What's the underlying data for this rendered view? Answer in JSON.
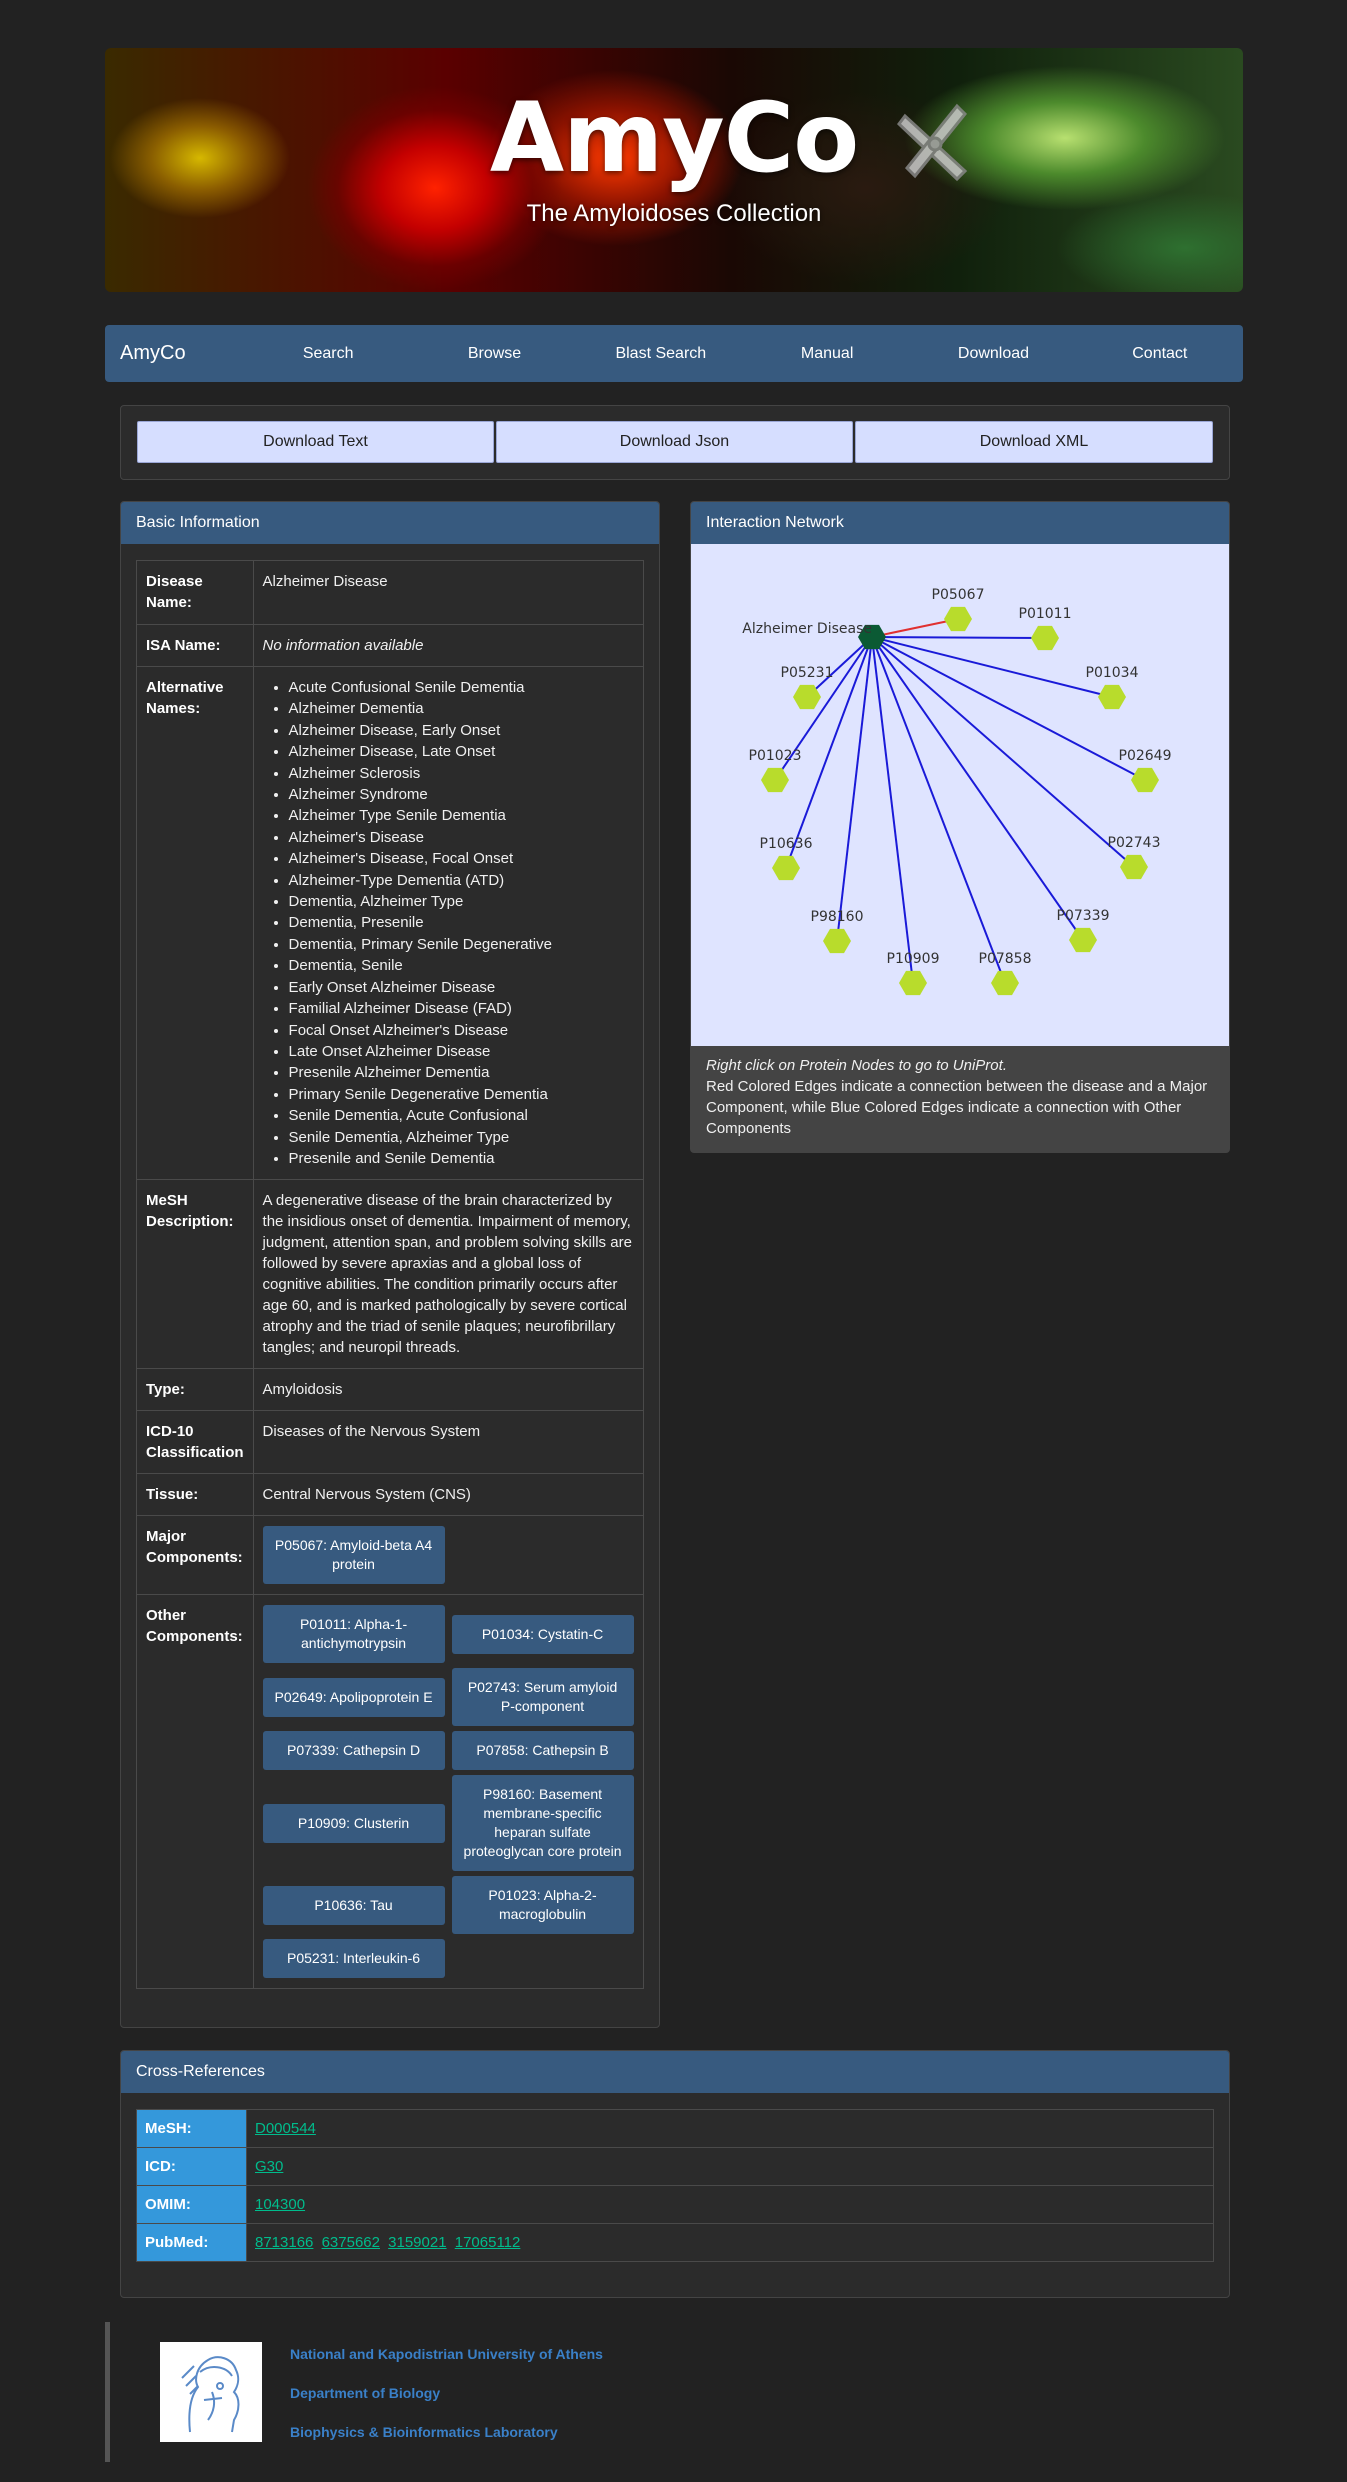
{
  "banner": {
    "title": "AmyCo",
    "subtitle": "The Amyloidoses Collection"
  },
  "navbar": {
    "brand": "AmyCo",
    "items": [
      "Search",
      "Browse",
      "Blast Search",
      "Manual",
      "Download",
      "Contact"
    ]
  },
  "downloads": {
    "text": "Download Text",
    "json": "Download Json",
    "xml": "Download XML"
  },
  "basic": {
    "header": "Basic Information",
    "disease_name_label": "Disease Name:",
    "disease_name": "Alzheimer Disease",
    "isa_label": "ISA Name:",
    "isa_value": "No information available",
    "alt_label": "Alternative Names:",
    "alt_names": [
      "Acute Confusional Senile Dementia",
      "Alzheimer Dementia",
      "Alzheimer Disease, Early Onset",
      "Alzheimer Disease, Late Onset",
      "Alzheimer Sclerosis",
      "Alzheimer Syndrome",
      "Alzheimer Type Senile Dementia",
      "Alzheimer's Disease",
      "Alzheimer's Disease, Focal Onset",
      "Alzheimer-Type Dementia (ATD)",
      "Dementia, Alzheimer Type",
      "Dementia, Presenile",
      "Dementia, Primary Senile Degenerative",
      "Dementia, Senile",
      "Early Onset Alzheimer Disease",
      "Familial Alzheimer Disease (FAD)",
      "Focal Onset Alzheimer's Disease",
      "Late Onset Alzheimer Disease",
      "Presenile Alzheimer Dementia",
      "Primary Senile Degenerative Dementia",
      "Senile Dementia, Acute Confusional",
      "Senile Dementia, Alzheimer Type",
      "Presenile and Senile Dementia"
    ],
    "mesh_label": "MeSH Description:",
    "mesh_desc": "A degenerative disease of the brain characterized by the insidious onset of dementia. Impairment of memory, judgment, attention span, and problem solving skills are followed by severe apraxias and a global loss of cognitive abilities. The condition primarily occurs after age 60, and is marked pathologically by severe cortical atrophy and the triad of senile plaques; neurofibrillary tangles; and neuropil threads.",
    "type_label": "Type:",
    "type_value": "Amyloidosis",
    "icd_label": "ICD-10 Classification",
    "icd_value": "Diseases of the Nervous System",
    "tissue_label": "Tissue:",
    "tissue_value": "Central Nervous System (CNS)",
    "major_label": "Major Components:",
    "major": [
      "P05067: Amyloid-beta A4 protein"
    ],
    "other_label": "Other Components:",
    "other": [
      "P01011: Alpha-1-antichymotrypsin",
      "P01034: Cystatin-C",
      "P02649: Apolipoprotein E",
      "P02743: Serum amyloid P-component",
      "P07339: Cathepsin D",
      "P07858: Cathepsin B",
      "P10909: Clusterin",
      "P98160: Basement membrane-specific heparan sulfate proteoglycan core protein",
      "P10636: Tau",
      "P01023: Alpha-2-macroglobulin",
      "P05231: Interleukin-6"
    ]
  },
  "network": {
    "header": "Interaction Network",
    "center_label": "Alzheimer Disease",
    "node_labels": [
      "P05067",
      "P01011",
      "P01034",
      "P02649",
      "P02743",
      "P07339",
      "P07858",
      "P10909",
      "P98160",
      "P10636",
      "P01023",
      "P05231"
    ],
    "major_edge_color": "#e03030",
    "other_edge_color": "#1a1ad8",
    "node_color": "#b8dc2c",
    "center_color": "#0b5a34",
    "caption_hint": "Right click on Protein Nodes to go to UniProt.",
    "caption_text": "Red Colored Edges indicate a connection between the disease and a Major Component, while Blue Colored Edges indicate a connection with Other Components"
  },
  "xref": {
    "header": "Cross-References",
    "mesh_label": "MeSH:",
    "mesh_links": [
      "D000544"
    ],
    "icd_label": "ICD:",
    "icd_links": [
      "G30"
    ],
    "omim_label": "OMIM:",
    "omim_links": [
      "104300"
    ],
    "pubmed_label": "PubMed:",
    "pubmed_links": [
      "8713166",
      "6375662",
      "3159021",
      "17065112"
    ]
  },
  "footer": {
    "university": "National and Kapodistrian University of Athens",
    "department": "Department of Biology",
    "lab": "Biophysics & Bioinformatics Laboratory"
  }
}
